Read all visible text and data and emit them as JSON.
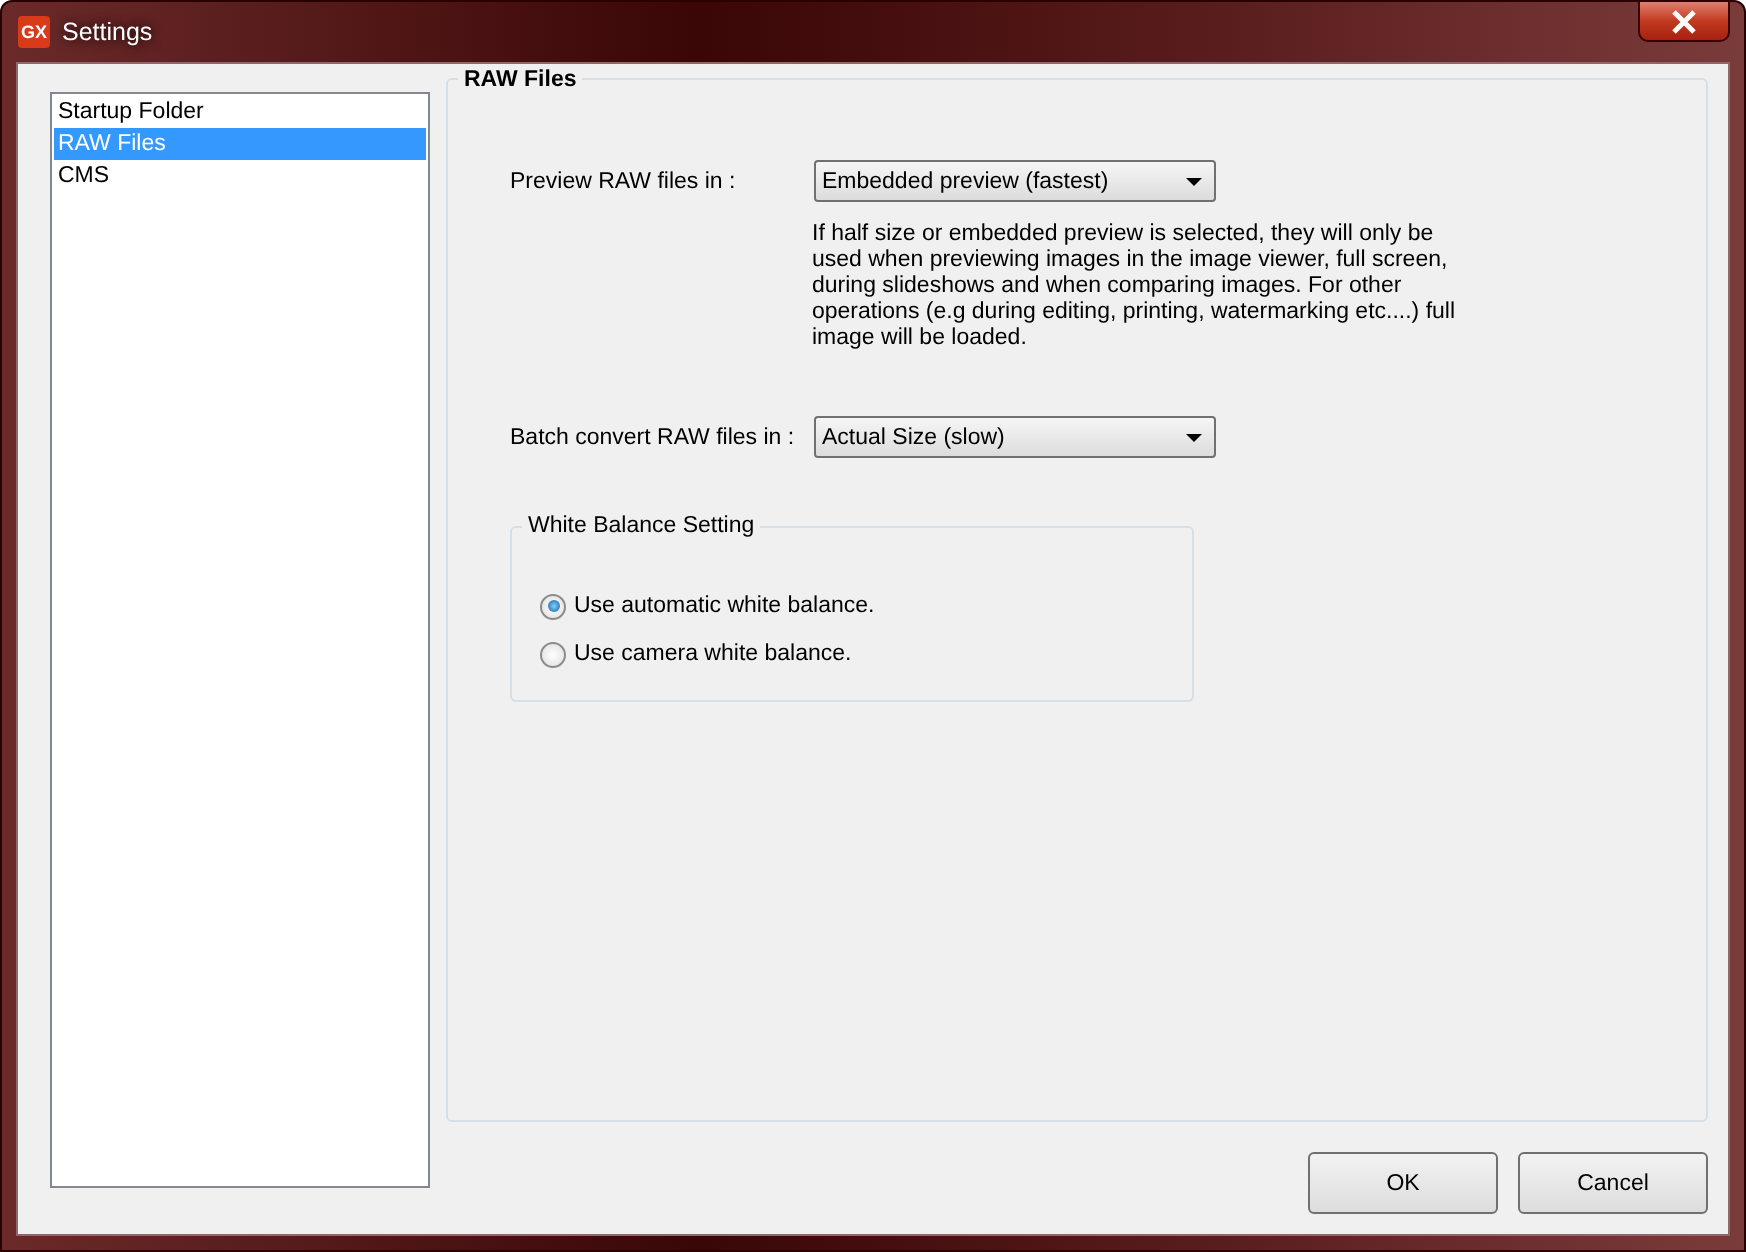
{
  "window": {
    "title": "Settings",
    "icon_text": "GX"
  },
  "sidebar": {
    "items": [
      {
        "label": "Startup Folder",
        "selected": false
      },
      {
        "label": "RAW Files",
        "selected": true
      },
      {
        "label": "CMS",
        "selected": false
      }
    ]
  },
  "panel": {
    "title": "RAW Files",
    "preview": {
      "label": "Preview RAW files in :",
      "value": "Embedded preview (fastest)"
    },
    "note": "If half size or embedded preview is selected, they will only be used when previewing images in the image viewer, full screen, during slideshows and when comparing images. For other operations (e.g during editing, printing, watermarking etc....) full image will be loaded.",
    "batch": {
      "label": "Batch convert RAW files in :",
      "value": "Actual Size (slow)"
    },
    "white_balance": {
      "title": "White Balance Setting",
      "options": [
        {
          "label": "Use automatic white balance.",
          "selected": true
        },
        {
          "label": "Use camera white balance.",
          "selected": false
        }
      ]
    }
  },
  "buttons": [
    "OK",
    "Cancel"
  ]
}
